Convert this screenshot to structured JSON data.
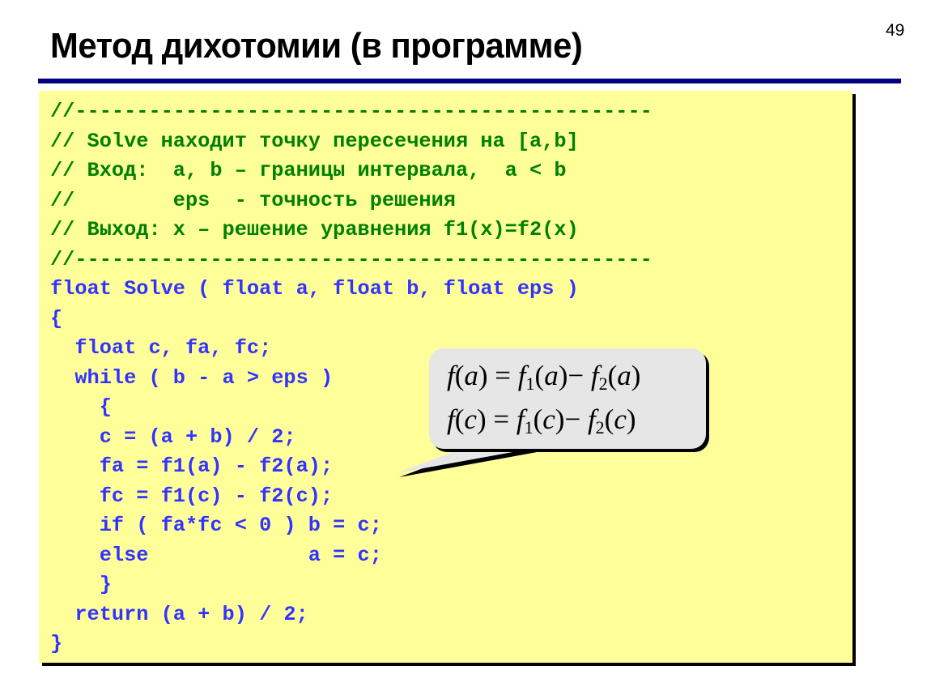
{
  "slide": {
    "number": "49",
    "title": "Метод дихотомии (в программе)"
  },
  "colors": {
    "title_rule": "#000080",
    "code_background": "#ffff99",
    "comment_color": "#008000",
    "code_color": "#3333ff",
    "callout_background": "#e6e6e6"
  },
  "code": {
    "lines": [
      {
        "kind": "comment",
        "text": "//-----------------------------------------------"
      },
      {
        "kind": "comment",
        "text": "// Solve находит точку пересечения на [a,b]"
      },
      {
        "kind": "comment",
        "text": "// Вход:  a, b – границы интервала,  a < b"
      },
      {
        "kind": "comment",
        "text": "//        eps  - точность решения"
      },
      {
        "kind": "comment",
        "text": "// Выход: x – решение уравнения f1(x)=f2(x)"
      },
      {
        "kind": "comment",
        "text": "//-----------------------------------------------"
      },
      {
        "kind": "code",
        "text": "float Solve ( float a, float b, float eps )"
      },
      {
        "kind": "code",
        "text": "{"
      },
      {
        "kind": "code",
        "text": "  float c, fa, fc;"
      },
      {
        "kind": "code",
        "text": "  while ( b - a > eps )"
      },
      {
        "kind": "code",
        "text": "    {"
      },
      {
        "kind": "code",
        "text": "    c = (a + b) / 2;"
      },
      {
        "kind": "code",
        "text": "    fa = f1(a) - f2(a);"
      },
      {
        "kind": "code",
        "text": "    fc = f1(c) - f2(c);"
      },
      {
        "kind": "code",
        "text": "    if ( fa*fc < 0 ) b = c;"
      },
      {
        "kind": "code",
        "text": "    else             a = c;"
      },
      {
        "kind": "code",
        "text": "    }"
      },
      {
        "kind": "code",
        "text": "  return (a + b) / 2;"
      },
      {
        "kind": "code",
        "text": "}"
      }
    ]
  },
  "callout": {
    "formula1": {
      "lhs_f": "f",
      "lhs_arg": "a",
      "eq": "=",
      "f1": "f",
      "sub1": "1",
      "arg1": "a",
      "minus": "−",
      "f2": "f",
      "sub2": "2",
      "arg2": "a"
    },
    "formula2": {
      "lhs_f": "f",
      "lhs_arg": "c",
      "eq": "=",
      "f1": "f",
      "sub1": "1",
      "arg1": "c",
      "minus": "−",
      "f2": "f",
      "sub2": "2",
      "arg2": "c"
    }
  }
}
